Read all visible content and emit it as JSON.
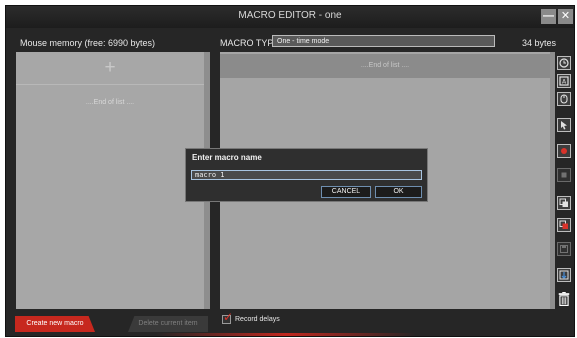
{
  "window": {
    "title": "MACRO EDITOR - one",
    "minimize_glyph": "—",
    "close_glyph": "✕"
  },
  "header": {
    "memory": "Mouse memory (free: 6990 bytes)",
    "macro_type_label": "MACRO TYPE",
    "macro_type_value": "One - time mode",
    "bytes": "34 bytes"
  },
  "left_panel": {
    "add_glyph": "+",
    "end_of_list": "....End of list ...."
  },
  "right_panel": {
    "end_of_list": "....End of list ...."
  },
  "dialog": {
    "title": "Enter macro name",
    "input_value": "macro 1",
    "cancel_label": "CANCEL",
    "ok_label": "OK"
  },
  "footer": {
    "create_label": "Create new macro",
    "delete_label": "Delete current item",
    "record_label": "Record delays",
    "record_checked": true,
    "check_glyph": "✓"
  },
  "toolbar_icons": [
    "clock-icon",
    "keyboard-key-icon",
    "mouse-icon",
    "cursor-arrow-icon",
    "record-icon",
    "stop-icon",
    "copy-icon",
    "paste-icon",
    "save-icon",
    "import-icon",
    "trash-icon"
  ],
  "colors": {
    "accent_red": "#c7281e",
    "panel_gray": "#a7a7a7",
    "window_bg": "#262626"
  }
}
